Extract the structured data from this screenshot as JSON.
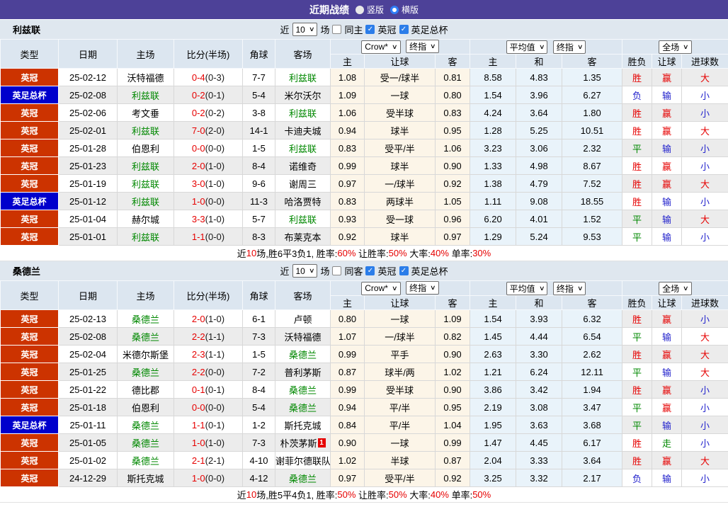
{
  "title_bar": {
    "title": "近期战绩",
    "vertical": "竖版",
    "horizontal": "横版"
  },
  "icons": {
    "chevron": "∨",
    "check": "✓"
  },
  "colors": {
    "header_purple": "#4d4198",
    "league_badge": "#cc3300",
    "cup_badge": "#0000cc",
    "team_green": "#008800",
    "win_red": "#e60000",
    "lose_blue": "#2222cc",
    "handicap_col_bg": "#fcf5e8",
    "avg_col_bg": "#e9f3fa"
  },
  "columns": {
    "type": "类型",
    "date": "日期",
    "home": "主场",
    "score": "比分(半场)",
    "corner": "角球",
    "away": "客场",
    "odds_home": "主",
    "handicap": "让球",
    "odds_away": "客",
    "avg_home": "主",
    "avg_draw": "和",
    "avg_away": "客",
    "winloss": "胜负",
    "handicap2": "让球",
    "goals": "进球数"
  },
  "selects": {
    "bookmaker": "Crow*",
    "final_index": "终指",
    "average": "平均值",
    "final_index2": "终指",
    "scope": "全场"
  },
  "sections": [
    {
      "team": "利兹联",
      "filter": {
        "prefix": "近",
        "count": "10",
        "suffix": "场",
        "same": "同主",
        "league": "英冠",
        "cup": "英足总杯"
      },
      "rows": [
        {
          "comp": "英冠",
          "cup": false,
          "date": "25-02-12",
          "home": "沃特福德",
          "home_hl": false,
          "score": "0-4",
          "half": "(0-3)",
          "corner": "7-7",
          "away": "利兹联",
          "away_hl": true,
          "o1": [
            "1.08",
            "受一/球半",
            "0.81"
          ],
          "o2": [
            "8.58",
            "4.83",
            "1.35"
          ],
          "res": [
            "胜",
            "r"
          ],
          "hres": [
            "赢",
            "r"
          ],
          "goal": [
            "大",
            "r"
          ]
        },
        {
          "comp": "英足总杯",
          "cup": true,
          "date": "25-02-08",
          "home": "利兹联",
          "home_hl": true,
          "score": "0-2",
          "half": "(0-1)",
          "corner": "5-4",
          "away": "米尔沃尔",
          "away_hl": false,
          "o1": [
            "1.09",
            "一球",
            "0.80"
          ],
          "o2": [
            "1.54",
            "3.96",
            "6.27"
          ],
          "res": [
            "负",
            "b"
          ],
          "hres": [
            "输",
            "b"
          ],
          "goal": [
            "小",
            "b"
          ]
        },
        {
          "comp": "英冠",
          "cup": false,
          "date": "25-02-06",
          "home": "考文垂",
          "home_hl": false,
          "score": "0-2",
          "half": "(0-2)",
          "corner": "3-8",
          "away": "利兹联",
          "away_hl": true,
          "o1": [
            "1.06",
            "受半球",
            "0.83"
          ],
          "o2": [
            "4.24",
            "3.64",
            "1.80"
          ],
          "res": [
            "胜",
            "r"
          ],
          "hres": [
            "赢",
            "r"
          ],
          "goal": [
            "小",
            "b"
          ]
        },
        {
          "comp": "英冠",
          "cup": false,
          "date": "25-02-01",
          "home": "利兹联",
          "home_hl": true,
          "score": "7-0",
          "half": "(2-0)",
          "corner": "14-1",
          "away": "卡迪夫城",
          "away_hl": false,
          "o1": [
            "0.94",
            "球半",
            "0.95"
          ],
          "o2": [
            "1.28",
            "5.25",
            "10.51"
          ],
          "res": [
            "胜",
            "r"
          ],
          "hres": [
            "赢",
            "r"
          ],
          "goal": [
            "大",
            "r"
          ]
        },
        {
          "comp": "英冠",
          "cup": false,
          "date": "25-01-28",
          "home": "伯恩利",
          "home_hl": false,
          "score": "0-0",
          "half": "(0-0)",
          "corner": "1-5",
          "away": "利兹联",
          "away_hl": true,
          "o1": [
            "0.83",
            "受平/半",
            "1.06"
          ],
          "o2": [
            "3.23",
            "3.06",
            "2.32"
          ],
          "res": [
            "平",
            "g"
          ],
          "hres": [
            "输",
            "b"
          ],
          "goal": [
            "小",
            "b"
          ]
        },
        {
          "comp": "英冠",
          "cup": false,
          "date": "25-01-23",
          "home": "利兹联",
          "home_hl": true,
          "score": "2-0",
          "half": "(1-0)",
          "corner": "8-4",
          "away": "诺维奇",
          "away_hl": false,
          "o1": [
            "0.99",
            "球半",
            "0.90"
          ],
          "o2": [
            "1.33",
            "4.98",
            "8.67"
          ],
          "res": [
            "胜",
            "r"
          ],
          "hres": [
            "赢",
            "r"
          ],
          "goal": [
            "小",
            "b"
          ]
        },
        {
          "comp": "英冠",
          "cup": false,
          "date": "25-01-19",
          "home": "利兹联",
          "home_hl": true,
          "score": "3-0",
          "half": "(1-0)",
          "corner": "9-6",
          "away": "谢周三",
          "away_hl": false,
          "o1": [
            "0.97",
            "一/球半",
            "0.92"
          ],
          "o2": [
            "1.38",
            "4.79",
            "7.52"
          ],
          "res": [
            "胜",
            "r"
          ],
          "hres": [
            "赢",
            "r"
          ],
          "goal": [
            "大",
            "r"
          ]
        },
        {
          "comp": "英足总杯",
          "cup": true,
          "date": "25-01-12",
          "home": "利兹联",
          "home_hl": true,
          "score": "1-0",
          "half": "(0-0)",
          "corner": "11-3",
          "away": "哈洛贾特",
          "away_hl": false,
          "o1": [
            "0.83",
            "两球半",
            "1.05"
          ],
          "o2": [
            "1.11",
            "9.08",
            "18.55"
          ],
          "res": [
            "胜",
            "r"
          ],
          "hres": [
            "输",
            "b"
          ],
          "goal": [
            "小",
            "b"
          ]
        },
        {
          "comp": "英冠",
          "cup": false,
          "date": "25-01-04",
          "home": "赫尔城",
          "home_hl": false,
          "score": "3-3",
          "half": "(1-0)",
          "corner": "5-7",
          "away": "利兹联",
          "away_hl": true,
          "o1": [
            "0.93",
            "受一球",
            "0.96"
          ],
          "o2": [
            "6.20",
            "4.01",
            "1.52"
          ],
          "res": [
            "平",
            "g"
          ],
          "hres": [
            "输",
            "b"
          ],
          "goal": [
            "大",
            "r"
          ]
        },
        {
          "comp": "英冠",
          "cup": false,
          "date": "25-01-01",
          "home": "利兹联",
          "home_hl": true,
          "score": "1-1",
          "half": "(0-0)",
          "corner": "8-3",
          "away": "布莱克本",
          "away_hl": false,
          "o1": [
            "0.92",
            "球半",
            "0.97"
          ],
          "o2": [
            "1.29",
            "5.24",
            "9.53"
          ],
          "res": [
            "平",
            "g"
          ],
          "hres": [
            "输",
            "b"
          ],
          "goal": [
            "小",
            "b"
          ]
        }
      ],
      "summary": [
        {
          "t": "近"
        },
        {
          "t": "10",
          "red": true
        },
        {
          "t": "场,胜6平3负1, 胜率:"
        },
        {
          "t": "60%",
          "red": true
        },
        {
          "t": " 让胜率:"
        },
        {
          "t": "50%",
          "red": true
        },
        {
          "t": " 大率:"
        },
        {
          "t": "40%",
          "red": true
        },
        {
          "t": " 单率:"
        },
        {
          "t": "30%",
          "red": true
        }
      ]
    },
    {
      "team": "桑德兰",
      "filter": {
        "prefix": "近",
        "count": "10",
        "suffix": "场",
        "same": "同客",
        "league": "英冠",
        "cup": "英足总杯"
      },
      "rows": [
        {
          "comp": "英冠",
          "cup": false,
          "date": "25-02-13",
          "home": "桑德兰",
          "home_hl": true,
          "score": "2-0",
          "half": "(1-0)",
          "corner": "6-1",
          "away": "卢顿",
          "away_hl": false,
          "o1": [
            "0.80",
            "一球",
            "1.09"
          ],
          "o2": [
            "1.54",
            "3.93",
            "6.32"
          ],
          "res": [
            "胜",
            "r"
          ],
          "hres": [
            "赢",
            "r"
          ],
          "goal": [
            "小",
            "b"
          ]
        },
        {
          "comp": "英冠",
          "cup": false,
          "date": "25-02-08",
          "home": "桑德兰",
          "home_hl": true,
          "score": "2-2",
          "half": "(1-1)",
          "corner": "7-3",
          "away": "沃特福德",
          "away_hl": false,
          "o1": [
            "1.07",
            "一/球半",
            "0.82"
          ],
          "o2": [
            "1.45",
            "4.44",
            "6.54"
          ],
          "res": [
            "平",
            "g"
          ],
          "hres": [
            "输",
            "b"
          ],
          "goal": [
            "大",
            "r"
          ]
        },
        {
          "comp": "英冠",
          "cup": false,
          "date": "25-02-04",
          "home": "米德尔斯堡",
          "home_hl": false,
          "score": "2-3",
          "half": "(1-1)",
          "corner": "1-5",
          "away": "桑德兰",
          "away_hl": true,
          "o1": [
            "0.99",
            "平手",
            "0.90"
          ],
          "o2": [
            "2.63",
            "3.30",
            "2.62"
          ],
          "res": [
            "胜",
            "r"
          ],
          "hres": [
            "赢",
            "r"
          ],
          "goal": [
            "大",
            "r"
          ]
        },
        {
          "comp": "英冠",
          "cup": false,
          "date": "25-01-25",
          "home": "桑德兰",
          "home_hl": true,
          "score": "2-2",
          "half": "(0-0)",
          "corner": "7-2",
          "away": "普利茅斯",
          "away_hl": false,
          "o1": [
            "0.87",
            "球半/两",
            "1.02"
          ],
          "o2": [
            "1.21",
            "6.24",
            "12.11"
          ],
          "res": [
            "平",
            "g"
          ],
          "hres": [
            "输",
            "b"
          ],
          "goal": [
            "大",
            "r"
          ]
        },
        {
          "comp": "英冠",
          "cup": false,
          "date": "25-01-22",
          "home": "德比郡",
          "home_hl": false,
          "score": "0-1",
          "half": "(0-1)",
          "corner": "8-4",
          "away": "桑德兰",
          "away_hl": true,
          "o1": [
            "0.99",
            "受半球",
            "0.90"
          ],
          "o2": [
            "3.86",
            "3.42",
            "1.94"
          ],
          "res": [
            "胜",
            "r"
          ],
          "hres": [
            "赢",
            "r"
          ],
          "goal": [
            "小",
            "b"
          ]
        },
        {
          "comp": "英冠",
          "cup": false,
          "date": "25-01-18",
          "home": "伯恩利",
          "home_hl": false,
          "score": "0-0",
          "half": "(0-0)",
          "corner": "5-4",
          "away": "桑德兰",
          "away_hl": true,
          "o1": [
            "0.94",
            "平/半",
            "0.95"
          ],
          "o2": [
            "2.19",
            "3.08",
            "3.47"
          ],
          "res": [
            "平",
            "g"
          ],
          "hres": [
            "赢",
            "r"
          ],
          "goal": [
            "小",
            "b"
          ]
        },
        {
          "comp": "英足总杯",
          "cup": true,
          "date": "25-01-11",
          "home": "桑德兰",
          "home_hl": true,
          "score": "1-1",
          "half": "(0-1)",
          "corner": "1-2",
          "away": "斯托克城",
          "away_hl": false,
          "o1": [
            "0.84",
            "平/半",
            "1.04"
          ],
          "o2": [
            "1.95",
            "3.63",
            "3.68"
          ],
          "res": [
            "平",
            "g"
          ],
          "hres": [
            "输",
            "b"
          ],
          "goal": [
            "小",
            "b"
          ]
        },
        {
          "comp": "英冠",
          "cup": false,
          "date": "25-01-05",
          "home": "桑德兰",
          "home_hl": true,
          "score": "1-0",
          "half": "(1-0)",
          "corner": "7-3",
          "away": "朴茨茅斯",
          "away_hl": false,
          "away_badge": "1",
          "o1": [
            "0.90",
            "一球",
            "0.99"
          ],
          "o2": [
            "1.47",
            "4.45",
            "6.17"
          ],
          "res": [
            "胜",
            "r"
          ],
          "hres": [
            "走",
            "g"
          ],
          "goal": [
            "小",
            "b"
          ]
        },
        {
          "comp": "英冠",
          "cup": false,
          "date": "25-01-02",
          "home": "桑德兰",
          "home_hl": true,
          "score": "2-1",
          "half": "(2-1)",
          "corner": "4-10",
          "away": "谢菲尔德联队",
          "away_hl": false,
          "o1": [
            "1.02",
            "半球",
            "0.87"
          ],
          "o2": [
            "2.04",
            "3.33",
            "3.64"
          ],
          "res": [
            "胜",
            "r"
          ],
          "hres": [
            "赢",
            "r"
          ],
          "goal": [
            "大",
            "r"
          ]
        },
        {
          "comp": "英冠",
          "cup": false,
          "date": "24-12-29",
          "home": "斯托克城",
          "home_hl": false,
          "score": "1-0",
          "half": "(0-0)",
          "corner": "4-12",
          "away": "桑德兰",
          "away_hl": true,
          "o1": [
            "0.97",
            "受平/半",
            "0.92"
          ],
          "o2": [
            "3.25",
            "3.32",
            "2.17"
          ],
          "res": [
            "负",
            "b"
          ],
          "hres": [
            "输",
            "b"
          ],
          "goal": [
            "小",
            "b"
          ]
        }
      ],
      "summary": [
        {
          "t": "近"
        },
        {
          "t": "10",
          "red": true
        },
        {
          "t": "场,胜5平4负1, 胜率:"
        },
        {
          "t": "50%",
          "red": true
        },
        {
          "t": " 让胜率:"
        },
        {
          "t": "50%",
          "red": true
        },
        {
          "t": " 大率:"
        },
        {
          "t": "40%",
          "red": true
        },
        {
          "t": " 单率:"
        },
        {
          "t": "50%",
          "red": true
        }
      ]
    }
  ]
}
